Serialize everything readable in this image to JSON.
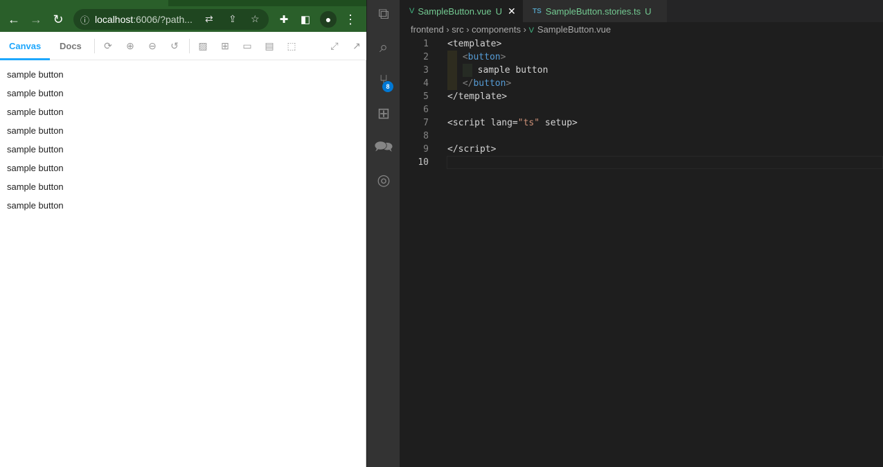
{
  "browser": {
    "url_host": "localhost",
    "url_rest": ":6006/?path...",
    "storybook": {
      "tabs": [
        "Canvas",
        "Docs"
      ]
    },
    "canvas_rows": [
      "sample button",
      "sample button",
      "sample button",
      "sample button",
      "sample button",
      "sample button",
      "sample button",
      "sample button"
    ]
  },
  "vscode": {
    "scm_badge": "8",
    "tabs": [
      {
        "icon": "V",
        "name": "SampleButton.vue",
        "status": "U",
        "close": "✕"
      },
      {
        "icon": "TS",
        "name": "SampleButton.stories.ts",
        "status": "U"
      }
    ],
    "breadcrumb": [
      "frontend",
      "src",
      "components",
      "SampleButton.vue"
    ],
    "lines": [
      {
        "n": "1",
        "tokens": [
          [
            "tk-text",
            "<template>"
          ]
        ]
      },
      {
        "n": "2",
        "guide": 1,
        "tokens": [
          [
            "tk-punct",
            "<"
          ],
          [
            "tk-tag",
            "button"
          ],
          [
            "tk-punct",
            ">"
          ]
        ]
      },
      {
        "n": "3",
        "guide": 2,
        "tokens": [
          [
            "tk-text",
            "sample button"
          ]
        ]
      },
      {
        "n": "4",
        "guide": 1,
        "tokens": [
          [
            "tk-punct",
            "</"
          ],
          [
            "tk-tag",
            "button"
          ],
          [
            "tk-punct",
            ">"
          ]
        ]
      },
      {
        "n": "5",
        "tokens": [
          [
            "tk-text",
            "</template>"
          ]
        ]
      },
      {
        "n": "6",
        "tokens": []
      },
      {
        "n": "7",
        "tokens": [
          [
            "tk-text",
            "<script lang="
          ],
          [
            "tk-str",
            "\"ts\""
          ],
          [
            "tk-text",
            " setup>"
          ]
        ]
      },
      {
        "n": "8",
        "tokens": []
      },
      {
        "n": "9",
        "tokens": [
          [
            "tk-text",
            "</script>"
          ]
        ]
      },
      {
        "n": "10",
        "current": true,
        "tokens": []
      }
    ]
  }
}
